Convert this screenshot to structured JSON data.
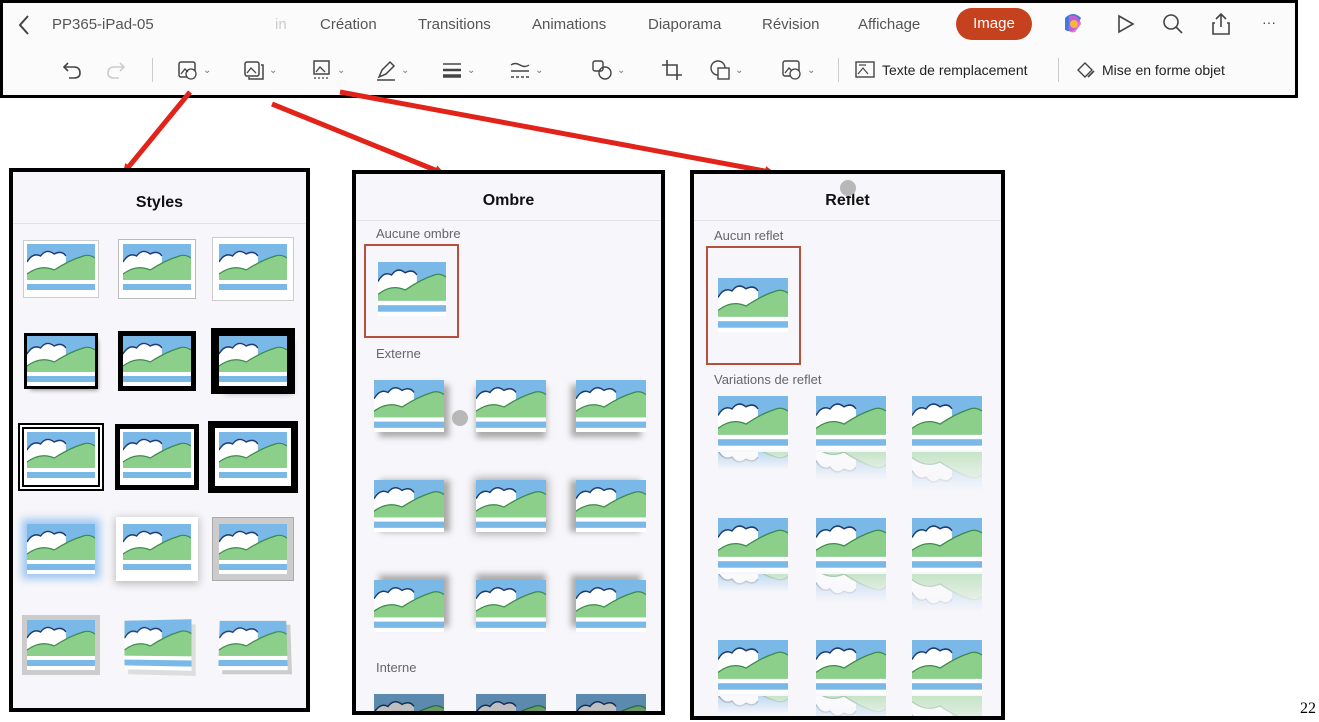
{
  "toolbar": {
    "back_label": "<",
    "file_name": "PP365-iPad-05",
    "faded_tab": "in",
    "tabs": [
      "Création",
      "Transitions",
      "Animations",
      "Diaporama",
      "Révision",
      "Affichage"
    ],
    "active_tab": "Image",
    "alt_text_label": "Texte de remplacement",
    "format_object_label": "Mise en forme objet",
    "more_label": "···"
  },
  "panels": {
    "styles": {
      "title": "Styles"
    },
    "shadow": {
      "title": "Ombre",
      "section_none": "Aucune ombre",
      "section_outer": "Externe",
      "section_inner": "Interne"
    },
    "reflection": {
      "title": "Reflet",
      "section_none": "Aucun reflet",
      "section_variations": "Variations de reflet"
    }
  },
  "page_number": "22",
  "colors": {
    "accent": "#c6421f",
    "selection": "#b4513a",
    "arrow": "#e2231a",
    "sky": "#7ab8e8",
    "hill": "#8ccf8a"
  }
}
